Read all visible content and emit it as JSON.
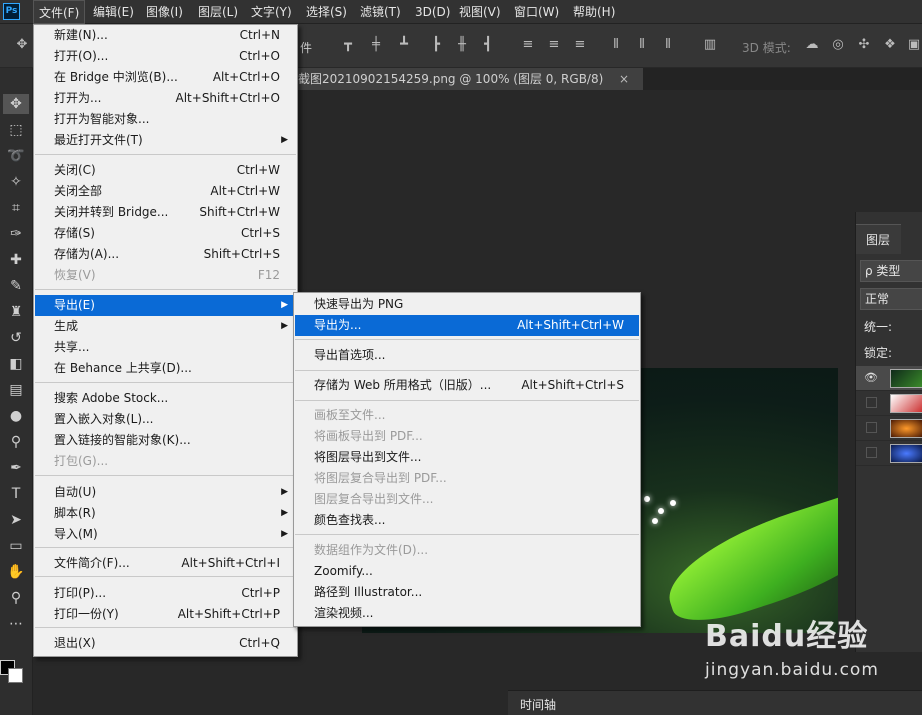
{
  "menubar": {
    "logo": "Ps",
    "items": [
      "文件(F)",
      "编辑(E)",
      "图像(I)",
      "图层(L)",
      "文字(Y)",
      "选择(S)",
      "滤镜(T)",
      "3D(D)",
      "视图(V)",
      "窗口(W)",
      "帮助(H)"
    ]
  },
  "options": {
    "partial_text": "件",
    "mode_label": "3D 模式:"
  },
  "document_tab": {
    "title": "截图20210902154259.png @ 100% (图层 0, RGB/8)",
    "close": "×"
  },
  "file_menu": {
    "items": [
      {
        "label": "新建(N)...",
        "shortcut": "Ctrl+N"
      },
      {
        "label": "打开(O)...",
        "shortcut": "Ctrl+O"
      },
      {
        "label": "在 Bridge 中浏览(B)...",
        "shortcut": "Alt+Ctrl+O"
      },
      {
        "label": "打开为...",
        "shortcut": "Alt+Shift+Ctrl+O"
      },
      {
        "label": "打开为智能对象...",
        "shortcut": ""
      },
      {
        "label": "最近打开文件(T)",
        "shortcut": "",
        "submenu": true
      },
      {
        "label": "关闭(C)",
        "shortcut": "Ctrl+W"
      },
      {
        "label": "关闭全部",
        "shortcut": "Alt+Ctrl+W"
      },
      {
        "label": "关闭并转到 Bridge...",
        "shortcut": "Shift+Ctrl+W"
      },
      {
        "label": "存储(S)",
        "shortcut": "Ctrl+S"
      },
      {
        "label": "存储为(A)...",
        "shortcut": "Shift+Ctrl+S"
      },
      {
        "label": "恢复(V)",
        "shortcut": "F12",
        "disabled": true
      },
      {
        "label": "导出(E)",
        "shortcut": "",
        "submenu": true,
        "highlighted": true
      },
      {
        "label": "生成",
        "shortcut": "",
        "submenu": true
      },
      {
        "label": "共享...",
        "shortcut": ""
      },
      {
        "label": "在 Behance 上共享(D)...",
        "shortcut": ""
      },
      {
        "label": "搜索 Adobe Stock...",
        "shortcut": ""
      },
      {
        "label": "置入嵌入对象(L)...",
        "shortcut": ""
      },
      {
        "label": "置入链接的智能对象(K)...",
        "shortcut": ""
      },
      {
        "label": "打包(G)...",
        "shortcut": "",
        "disabled": true
      },
      {
        "label": "自动(U)",
        "shortcut": "",
        "submenu": true
      },
      {
        "label": "脚本(R)",
        "shortcut": "",
        "submenu": true
      },
      {
        "label": "导入(M)",
        "shortcut": "",
        "submenu": true
      },
      {
        "label": "文件简介(F)...",
        "shortcut": "Alt+Shift+Ctrl+I"
      },
      {
        "label": "打印(P)...",
        "shortcut": "Ctrl+P"
      },
      {
        "label": "打印一份(Y)",
        "shortcut": "Alt+Shift+Ctrl+P"
      },
      {
        "label": "退出(X)",
        "shortcut": "Ctrl+Q"
      }
    ]
  },
  "export_menu": {
    "items": [
      {
        "label": "快速导出为 PNG",
        "shortcut": ""
      },
      {
        "label": "导出为...",
        "shortcut": "Alt+Shift+Ctrl+W",
        "highlighted": true
      },
      {
        "label": "导出首选项...",
        "shortcut": ""
      },
      {
        "label": "存储为 Web 所用格式（旧版）...",
        "shortcut": "Alt+Shift+Ctrl+S"
      },
      {
        "label": "画板至文件...",
        "shortcut": "",
        "disabled": true
      },
      {
        "label": "将画板导出到 PDF...",
        "shortcut": "",
        "disabled": true
      },
      {
        "label": "将图层导出到文件...",
        "shortcut": ""
      },
      {
        "label": "将图层复合导出到 PDF...",
        "shortcut": "",
        "disabled": true
      },
      {
        "label": "图层复合导出到文件...",
        "shortcut": "",
        "disabled": true
      },
      {
        "label": "颜色查找表...",
        "shortcut": ""
      },
      {
        "label": "数据组作为文件(D)...",
        "shortcut": "",
        "disabled": true
      },
      {
        "label": "Zoomify...",
        "shortcut": ""
      },
      {
        "label": "路径到 Illustrator...",
        "shortcut": ""
      },
      {
        "label": "渲染视频...",
        "shortcut": ""
      }
    ]
  },
  "layers_panel": {
    "tab": "图层",
    "filter": "ρ 类型",
    "blend_mode": "正常",
    "unify_label": "统一:",
    "lock_label": "锁定:"
  },
  "timeline": {
    "label": "时间轴"
  },
  "watermark": {
    "brand": "Baidu经验",
    "url": "jingyan.baidu.com"
  }
}
